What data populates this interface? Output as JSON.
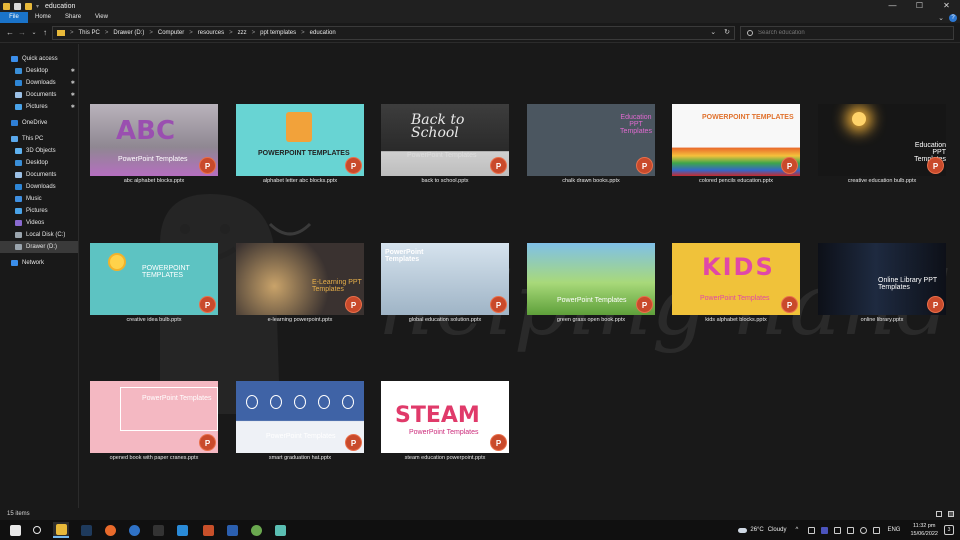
{
  "window": {
    "title": "education",
    "controls": [
      "—",
      "☐",
      "✕"
    ]
  },
  "ribbon": {
    "tabs": [
      "File",
      "Home",
      "Share",
      "View"
    ],
    "expand_glyph": "⌄",
    "help_glyph": "?"
  },
  "address": {
    "back": "←",
    "forward": "→",
    "recent": "⌄",
    "up": "↑",
    "breadcrumb": [
      "This PC",
      "Drawer (D:)",
      "Computer",
      "resources",
      "zzz",
      "ppt templates",
      "education"
    ],
    "separator": ">",
    "dropdown_glyph": "⌄",
    "refresh_glyph": "↻"
  },
  "search": {
    "placeholder": "Search education"
  },
  "sidebar": {
    "items": [
      {
        "label": "Quick access",
        "color": "#3b8eea",
        "level": 0,
        "pinned": false
      },
      {
        "label": "Desktop",
        "color": "#3a8fd8",
        "level": 1,
        "pinned": true
      },
      {
        "label": "Downloads",
        "color": "#2e86d6",
        "level": 1,
        "pinned": true
      },
      {
        "label": "Documents",
        "color": "#9cc0e6",
        "level": 1,
        "pinned": true
      },
      {
        "label": "Pictures",
        "color": "#4aa3e8",
        "level": 1,
        "pinned": true
      },
      {
        "label": "OneDrive",
        "color": "#2f7fd6",
        "level": 0,
        "pinned": false
      },
      {
        "label": "This PC",
        "color": "#5aa8ec",
        "level": 0,
        "pinned": false
      },
      {
        "label": "3D Objects",
        "color": "#5fb2f0",
        "level": 1,
        "pinned": false
      },
      {
        "label": "Desktop",
        "color": "#3a8fd8",
        "level": 1,
        "pinned": false
      },
      {
        "label": "Documents",
        "color": "#9cc0e6",
        "level": 1,
        "pinned": false
      },
      {
        "label": "Downloads",
        "color": "#2e86d6",
        "level": 1,
        "pinned": false
      },
      {
        "label": "Music",
        "color": "#3f8fe0",
        "level": 1,
        "pinned": false
      },
      {
        "label": "Pictures",
        "color": "#4aa3e8",
        "level": 1,
        "pinned": false
      },
      {
        "label": "Videos",
        "color": "#8a6ad0",
        "level": 1,
        "pinned": false
      },
      {
        "label": "Local Disk (C:)",
        "color": "#9aa4ad",
        "level": 1,
        "pinned": false
      },
      {
        "label": "Drawer (D:)",
        "color": "#9aa4ad",
        "level": 1,
        "pinned": false,
        "selected": true
      },
      {
        "label": "Network",
        "color": "#3b8eea",
        "level": 0,
        "pinned": false
      }
    ]
  },
  "files": [
    {
      "name": "abc alphabet blocks.pptx",
      "thumb_text": "PowerPoint Templates",
      "bg": "#a79aa9",
      "text_color": "#ffffff"
    },
    {
      "name": "alphabet letter abc blocks.pptx",
      "thumb_text": "POWERPOINT TEMPLATES",
      "bg": "#68d4d3",
      "text_color": "#222222"
    },
    {
      "name": "back to school.pptx",
      "thumb_text": "PowerPoint Templates",
      "bg": "#3a3a3a",
      "text_color": "#dddddd"
    },
    {
      "name": "chalk drawn books.pptx",
      "thumb_text": "Education PPT Templates",
      "bg": "#4b5660",
      "text_color": "#e06ad0"
    },
    {
      "name": "colored pencils education.pptx",
      "thumb_text": "POWERPOINT TEMPLATES",
      "bg": "#f6f6f6",
      "text_color": "#e0722e"
    },
    {
      "name": "creative education bulb.pptx",
      "thumb_text": "Education PPT Templates",
      "bg": "#161616",
      "text_color": "#ffffff"
    },
    {
      "name": "creative idea bulb.pptx",
      "thumb_text": "POWERPOINT TEMPLATES",
      "bg": "#5dc3c2",
      "text_color": "#ffffff"
    },
    {
      "name": "e-learning powerpoint.pptx",
      "thumb_text": "E-Learning PPT Templates",
      "bg": "#3a3230",
      "text_color": "#e8b04a"
    },
    {
      "name": "global education solution.pptx",
      "thumb_text": "PowerPoint Templates",
      "bg": "#b9cbd8",
      "text_color": "#ffffff"
    },
    {
      "name": "green grass open book.pptx",
      "thumb_text": "PowerPoint Templates",
      "bg": "#7fb85a",
      "text_color": "#ffffff"
    },
    {
      "name": "kids alphabet blocks.pptx",
      "thumb_text": "PowerPoint Templates",
      "bg": "#f0c23a",
      "text_color": "#e048a8"
    },
    {
      "name": "online library.pptx",
      "thumb_text": "Online Library PPT Templates",
      "bg": "#141820",
      "text_color": "#ffffff"
    },
    {
      "name": "opened book with paper cranes.pptx",
      "thumb_text": "PowerPoint Templates",
      "bg": "#f4b8c2",
      "text_color": "#ffffff"
    },
    {
      "name": "smart graduation hat.pptx",
      "thumb_text": "PowerPoint Templates",
      "bg": "#3f63a6",
      "text_color": "#ffffff"
    },
    {
      "name": "steam education powerpoint.pptx",
      "thumb_text": "PowerPoint Templates",
      "bg": "#ffffff",
      "text_color": "#cc2a7a"
    }
  ],
  "thumb_decor": {
    "abc": "ABC",
    "kids": "KIDS",
    "steam": "STEAM",
    "back_to_school": "Back to School",
    "ppt_letter": "P"
  },
  "watermark": {
    "text": "helping hand"
  },
  "status": {
    "item_count": "15 items"
  },
  "taskbar": {
    "apps": [
      {
        "name": "start",
        "color": "#e8e8e8"
      },
      {
        "name": "search",
        "color": "#e8e8e8"
      },
      {
        "name": "file-explorer",
        "color": "#e8b93a",
        "active": true
      },
      {
        "name": "photoshop",
        "color": "#1e3a5c"
      },
      {
        "name": "firefox",
        "color": "#e86a2b"
      },
      {
        "name": "thunderbird",
        "color": "#2f72c6"
      },
      {
        "name": "terminal",
        "color": "#333333"
      },
      {
        "name": "vscode",
        "color": "#2a8bd8"
      },
      {
        "name": "filezilla",
        "color": "#c8502a"
      },
      {
        "name": "word",
        "color": "#2b5faf"
      },
      {
        "name": "chrome-app",
        "color": "#6aa84f"
      },
      {
        "name": "notes",
        "color": "#5bbfb3"
      }
    ],
    "weather": {
      "temp": "26°C",
      "condition": "Cloudy"
    },
    "language": "ENG",
    "time": "11:32 pm",
    "date": "15/06/2022",
    "notification_count": "3"
  }
}
